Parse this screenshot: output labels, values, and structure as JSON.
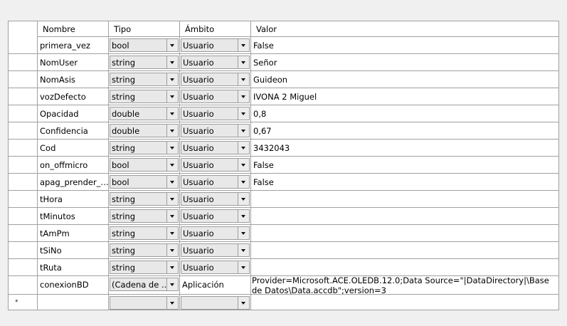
{
  "columns": [
    "Nombre",
    "Tipo",
    "Ámbito",
    "Valor"
  ],
  "rows": [
    {
      "name": "primera_vez",
      "type": "bool",
      "scope": "Usuario",
      "value": "False"
    },
    {
      "name": "NomUser",
      "type": "string",
      "scope": "Usuario",
      "value": "Señor"
    },
    {
      "name": "NomAsis",
      "type": "string",
      "scope": "Usuario",
      "value": "Guideon"
    },
    {
      "name": "vozDefecto",
      "type": "string",
      "scope": "Usuario",
      "value": "IVONA 2 Miguel"
    },
    {
      "name": "Opacidad",
      "type": "double",
      "scope": "Usuario",
      "value": "0,8"
    },
    {
      "name": "Confidencia",
      "type": "double",
      "scope": "Usuario",
      "value": "0,67"
    },
    {
      "name": "Cod",
      "type": "string",
      "scope": "Usuario",
      "value": "3432043"
    },
    {
      "name": "on_offmicro",
      "type": "bool",
      "scope": "Usuario",
      "value": "False"
    },
    {
      "name": "apag_prender_...",
      "type": "bool",
      "scope": "Usuario",
      "value": "False"
    },
    {
      "name": "tHora",
      "type": "string",
      "scope": "Usuario",
      "value": ""
    },
    {
      "name": "tMinutos",
      "type": "string",
      "scope": "Usuario",
      "value": ""
    },
    {
      "name": "tAmPm",
      "type": "string",
      "scope": "Usuario",
      "value": ""
    },
    {
      "name": "tSiNo",
      "type": "string",
      "scope": "Usuario",
      "value": ""
    },
    {
      "name": "tRuta",
      "type": "string",
      "scope": "Usuario",
      "value": ""
    },
    {
      "name": "conexionBD",
      "type": "(Cadena de ...",
      "scope": "Aplicación",
      "value": "Provider=Microsoft.ACE.OLEDB.12.0;Data Source=\"|DataDirectory|\\Base de Datos\\Data.accdb\";version=3"
    }
  ],
  "new_row": {
    "marker": "*",
    "type": "",
    "scope": ""
  },
  "icons": {
    "dropdown": "chevron-down-icon",
    "new_row": "asterisk-icon"
  }
}
